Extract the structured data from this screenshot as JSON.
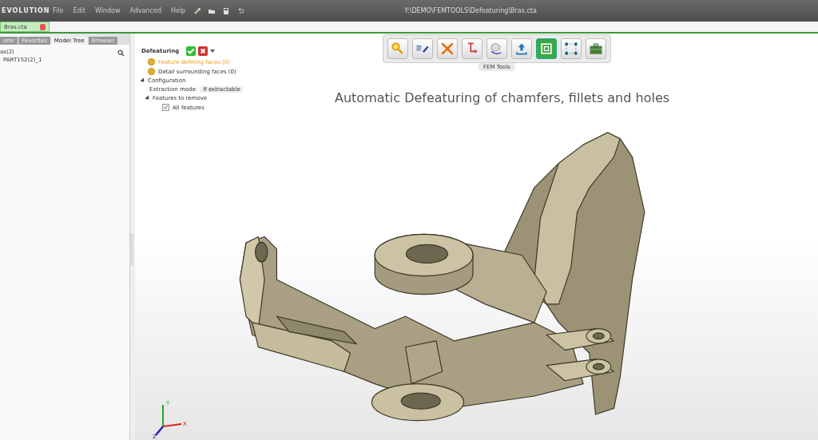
{
  "window": {
    "app_name": "EVOLUTION",
    "title": "Y:\\DEMO\\FEMTOOLS\\Defeaturing\\Bras.cta"
  },
  "menu": [
    "File",
    "Edit",
    "Window",
    "Advanced",
    "Help"
  ],
  "document_tabs": [
    {
      "label": "Bras.cta",
      "selected": true
    }
  ],
  "panel_tabs": [
    {
      "label": "orer",
      "selected": false
    },
    {
      "label": "Favorites",
      "selected": false
    },
    {
      "label": "Model Tree",
      "selected": true
    },
    {
      "label": "Browser",
      "selected": false
    }
  ],
  "tree": [
    {
      "label": "as(2)",
      "children": [
        {
          "label": "PART152(2)_1"
        }
      ]
    }
  ],
  "defeaturing": {
    "title": "Defeaturing",
    "selections": [
      {
        "label": "Feature defining faces (0)",
        "selected": true
      },
      {
        "label": "Detail surrounding faces (0)",
        "selected": false
      }
    ],
    "configuration": {
      "label": "Configuration",
      "expanded": true,
      "extraction_mode_label": "Extraction mode:",
      "extraction_mode": "If extractable",
      "features": {
        "label": "Features to remove",
        "expanded": true,
        "items": [
          {
            "label": "All features",
            "checked": true
          }
        ]
      }
    }
  },
  "toolbar": {
    "label": "FEM Tools",
    "buttons": [
      {
        "kind": "search",
        "selected": false
      },
      {
        "kind": "edit",
        "selected": false
      },
      {
        "kind": "tools",
        "selected": false
      },
      {
        "kind": "beam",
        "selected": false
      },
      {
        "kind": "rotate",
        "selected": false
      },
      {
        "kind": "upload",
        "selected": false
      },
      {
        "kind": "frame",
        "selected": true
      },
      {
        "kind": "nodes",
        "selected": false
      },
      {
        "kind": "case",
        "selected": false
      }
    ]
  },
  "viewport": {
    "caption": "Automatic Defeaturing of chamfers, fillets and holes",
    "axes": [
      "Y",
      "X",
      "Z"
    ]
  }
}
